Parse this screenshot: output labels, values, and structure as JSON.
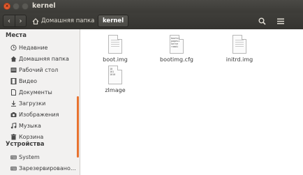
{
  "window": {
    "title": "kernel"
  },
  "toolbar": {
    "back_glyph": "‹",
    "forward_glyph": "›",
    "breadcrumb_home": "Домашняя папка",
    "breadcrumb_current": "kernel"
  },
  "sidebar": {
    "places_heading": "Места",
    "places": [
      {
        "label": "Недавние",
        "icon": "clock-icon"
      },
      {
        "label": "Домашняя папка",
        "icon": "home-icon"
      },
      {
        "label": "Рабочий стол",
        "icon": "desktop-icon"
      },
      {
        "label": "Видео",
        "icon": "video-icon"
      },
      {
        "label": "Документы",
        "icon": "document-icon"
      },
      {
        "label": "Загрузки",
        "icon": "download-icon"
      },
      {
        "label": "Изображения",
        "icon": "camera-icon"
      },
      {
        "label": "Музыка",
        "icon": "music-icon"
      },
      {
        "label": "Корзина",
        "icon": "trash-icon"
      }
    ],
    "devices_heading": "Устройства",
    "devices": [
      {
        "label": "System",
        "icon": "drive-icon"
      },
      {
        "label": "Зарезервировано…",
        "icon": "drive-icon"
      }
    ]
  },
  "files": [
    {
      "name": "boot.img",
      "icon": "generic-file-icon"
    },
    {
      "name": "bootimg.cfg",
      "icon": "text-file-icon",
      "preview": [
        "bootsi",
        "pagesi",
        "kerne",
        "ramdi"
      ]
    },
    {
      "name": "initrd.img",
      "icon": "generic-file-icon"
    },
    {
      "name": "zImage",
      "icon": "binary-file-icon",
      "preview": [
        "10",
        "101",
        "1010"
      ]
    }
  ],
  "colors": {
    "accent": "#e8722f",
    "titlebar": "#3c3b37",
    "close": "#e85c2f"
  }
}
